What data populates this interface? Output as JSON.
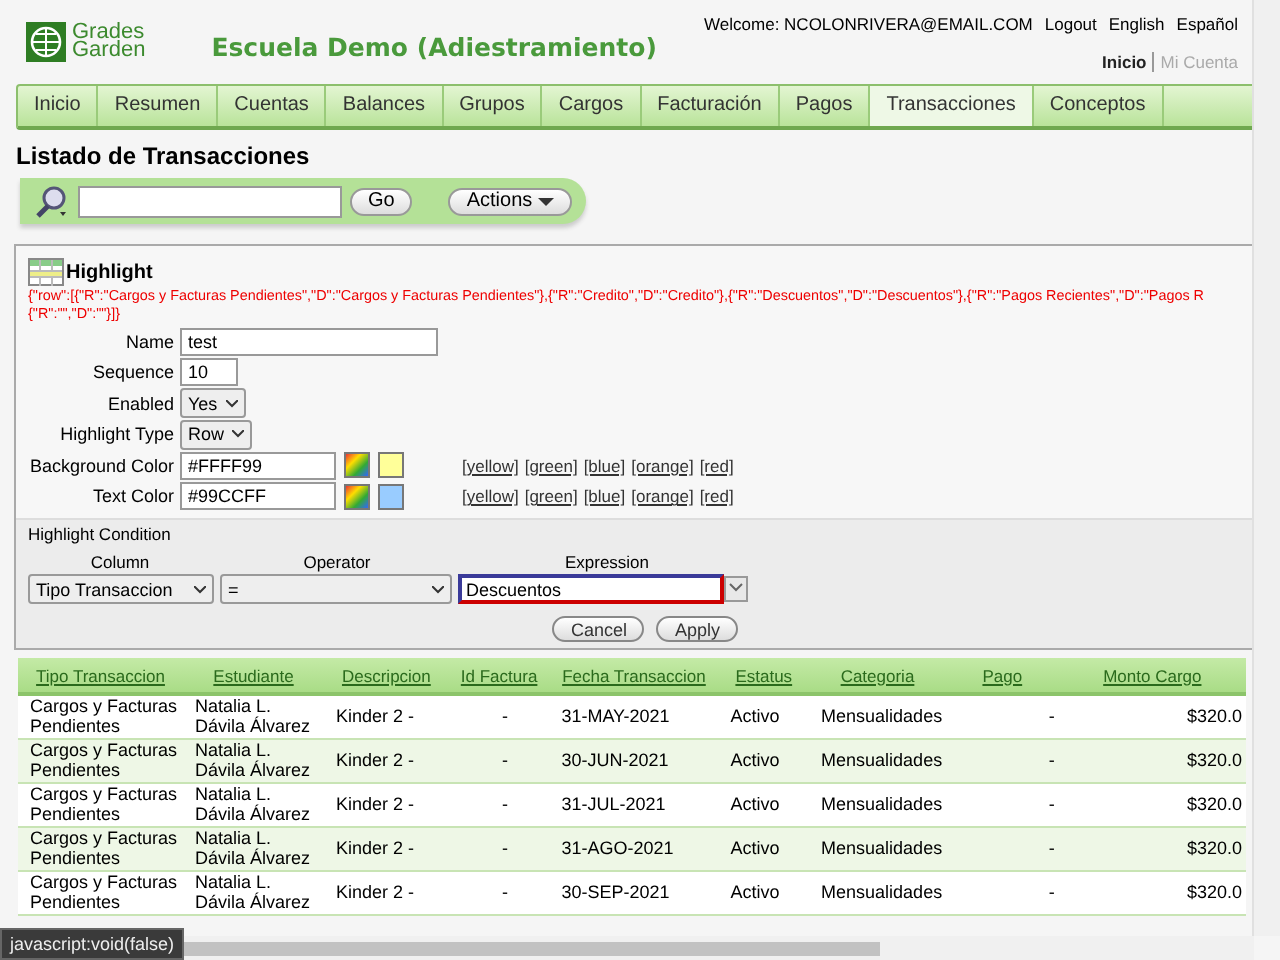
{
  "header": {
    "logo_line1": "Grades",
    "logo_line2": "Garden",
    "school": "Escuela Demo (Adiestramiento)",
    "welcome": "Welcome: NCOLONRIVERA@EMAIL.COM",
    "links": [
      "Logout",
      "English",
      "Español"
    ],
    "user_links": [
      {
        "label": "Inicio",
        "selected": true
      },
      {
        "label": "Mi Cuenta",
        "selected": false
      }
    ]
  },
  "nav": [
    {
      "label": "Inicio",
      "selected": false
    },
    {
      "label": "Resumen",
      "selected": false
    },
    {
      "label": "Cuentas",
      "selected": false
    },
    {
      "label": "Balances",
      "selected": false
    },
    {
      "label": "Grupos",
      "selected": false
    },
    {
      "label": "Cargos",
      "selected": false
    },
    {
      "label": "Facturación",
      "selected": false
    },
    {
      "label": "Pagos",
      "selected": false
    },
    {
      "label": "Transacciones",
      "selected": true
    },
    {
      "label": "Conceptos",
      "selected": false
    }
  ],
  "page_title": "Listado de Transacciones",
  "search": {
    "go_button": "Go",
    "actions_button": "Actions"
  },
  "highlight": {
    "title": "Highlight",
    "debug_lines": [
      "{\"row\":[{\"R\":\"Cargos y Facturas Pendientes\",\"D\":\"Cargos y Facturas Pendientes\"},{\"R\":\"Credito\",\"D\":\"Credito\"},{\"R\":\"Descuentos\",\"D\":\"Descuentos\"},{\"R\":\"Pagos Recientes\",\"D\":\"Pagos R",
      "{\"R\":\"\",\"D\":\"\"}]}"
    ],
    "fields": [
      {
        "kind": "text",
        "label": "Name",
        "value": "test"
      },
      {
        "kind": "number",
        "label": "Sequence",
        "value": "10"
      },
      {
        "kind": "select",
        "label": "Enabled",
        "value": "Yes"
      },
      {
        "kind": "select",
        "label": "Highlight Type",
        "value": "Row"
      },
      {
        "kind": "color",
        "label": "Background Color",
        "value": "#FFFF99",
        "presets": [
          "[yellow]",
          "[green]",
          "[blue]",
          "[orange]",
          "[red]"
        ]
      },
      {
        "kind": "color",
        "label": "Text Color",
        "value": "#99CCFF",
        "presets": [
          "[yellow]",
          "[green]",
          "[blue]",
          "[orange]",
          "[red]"
        ]
      }
    ],
    "condition": {
      "title": "Highlight Condition",
      "column_header": "Column",
      "operator_header": "Operator",
      "expression_header": "Expression",
      "column": "Tipo Transaccion",
      "operator": "=",
      "expression": "Descuentos"
    },
    "buttons": [
      "Cancel",
      "Apply"
    ]
  },
  "table": {
    "columns": [
      "Tipo Transaccion",
      "Estudiante",
      "Descripcion",
      "Id Factura",
      "Fecha Transaccion",
      "Estatus",
      "Categoria",
      "Pago",
      "Monto Cargo"
    ],
    "rows": [
      [
        "Cargos y Facturas Pendientes",
        "Natalia L. Dávila Álvarez",
        "Kinder 2 -",
        "-",
        "31-MAY-2021",
        "Activo",
        "Mensualidades",
        "-",
        "$320.0"
      ],
      [
        "Cargos y Facturas Pendientes",
        "Natalia L. Dávila Álvarez",
        "Kinder 2 -",
        "-",
        "30-JUN-2021",
        "Activo",
        "Mensualidades",
        "-",
        "$320.0"
      ],
      [
        "Cargos y Facturas Pendientes",
        "Natalia L. Dávila Álvarez",
        "Kinder 2 -",
        "-",
        "31-JUL-2021",
        "Activo",
        "Mensualidades",
        "-",
        "$320.0"
      ],
      [
        "Cargos y Facturas Pendientes",
        "Natalia L. Dávila Álvarez",
        "Kinder 2 -",
        "-",
        "31-AGO-2021",
        "Activo",
        "Mensualidades",
        "-",
        "$320.0"
      ],
      [
        "Cargos y Facturas Pendientes",
        "Natalia L. Dávila Álvarez",
        "Kinder 2 -",
        "-",
        "30-SEP-2021",
        "Activo",
        "Mensualidades",
        "-",
        "$320.0"
      ]
    ]
  },
  "status_tip": "javascript:void(false)"
}
